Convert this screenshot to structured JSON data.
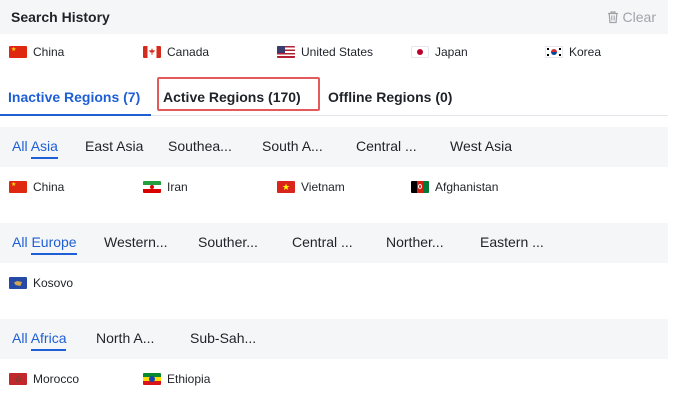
{
  "search_history": {
    "title": "Search History",
    "clear_label": "Clear",
    "items": [
      "China",
      "Canada",
      "United States",
      "Japan",
      "Korea"
    ]
  },
  "tabs": [
    {
      "label": "Inactive Regions (7)"
    },
    {
      "label": "Active Regions (170)"
    },
    {
      "label": "Offline Regions (0)"
    }
  ],
  "groups": {
    "asia": {
      "all_prefix": "All ",
      "all_name": "Asia",
      "subregions": [
        "East Asia",
        "Southea...",
        "South A...",
        "Central ...",
        "West Asia"
      ],
      "countries": [
        "China",
        "Iran",
        "Vietnam",
        "Afghanistan"
      ]
    },
    "europe": {
      "all_prefix": "All ",
      "all_name": "Europe",
      "subregions": [
        "Western...",
        "Souther...",
        "Central ...",
        "Norther...",
        "Eastern ..."
      ],
      "countries": [
        "Kosovo"
      ]
    },
    "africa": {
      "all_prefix": "All ",
      "all_name": "Africa",
      "subregions": [
        "North A...",
        "Sub-Sah..."
      ],
      "countries": [
        "Morocco",
        "Ethiopia"
      ]
    }
  },
  "colors": {
    "accent": "#1e5fd6",
    "highlight_border": "#e45a5a",
    "bar_background": "#f5f6f7"
  }
}
